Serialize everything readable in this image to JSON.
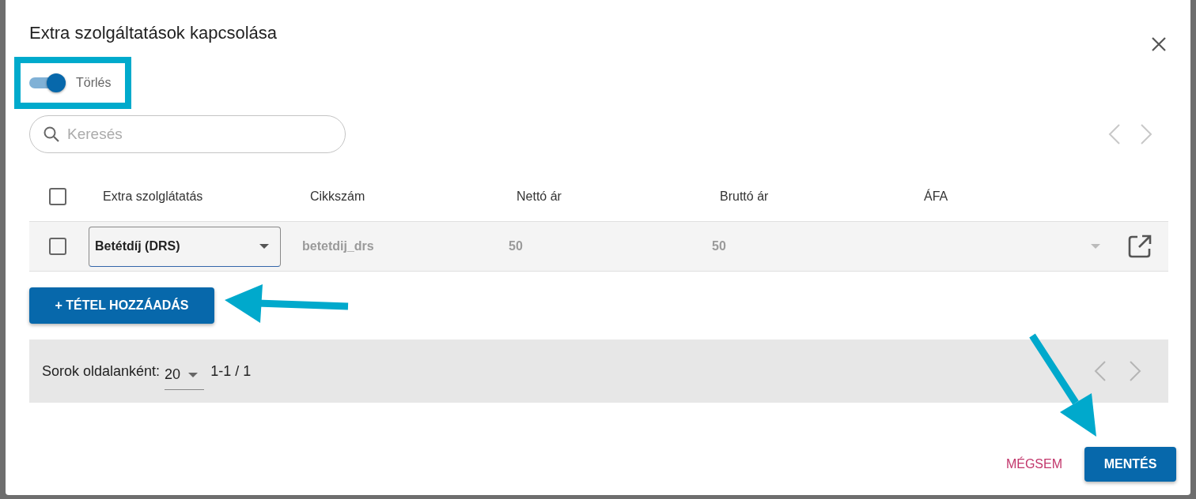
{
  "dialog": {
    "title": "Extra szolgáltatások kapcsolása",
    "toggle": {
      "label": "Törlés",
      "on": true
    },
    "search": {
      "placeholder": "Keresés"
    },
    "table": {
      "all_checked": false,
      "columns": [
        "Extra szolglátatás",
        "Cikkszám",
        "Nettó ár",
        "Bruttó ár",
        "ÁFA"
      ],
      "rows": [
        {
          "checked": false,
          "service": "Betétdíj (DRS)",
          "sku": "betetdij_drs",
          "net": "50",
          "gross": "50"
        }
      ]
    },
    "add_button": "+ TÉTEL HOZZÁADÁS",
    "pagination": {
      "label": "Sorok oldalanként:",
      "rows_per_page": "20",
      "range": "1-1 / 1"
    },
    "buttons": [
      {
        "label": "MÉGSEM",
        "kind": "text"
      },
      {
        "label": "MENTÉS",
        "kind": "primary"
      }
    ]
  }
}
